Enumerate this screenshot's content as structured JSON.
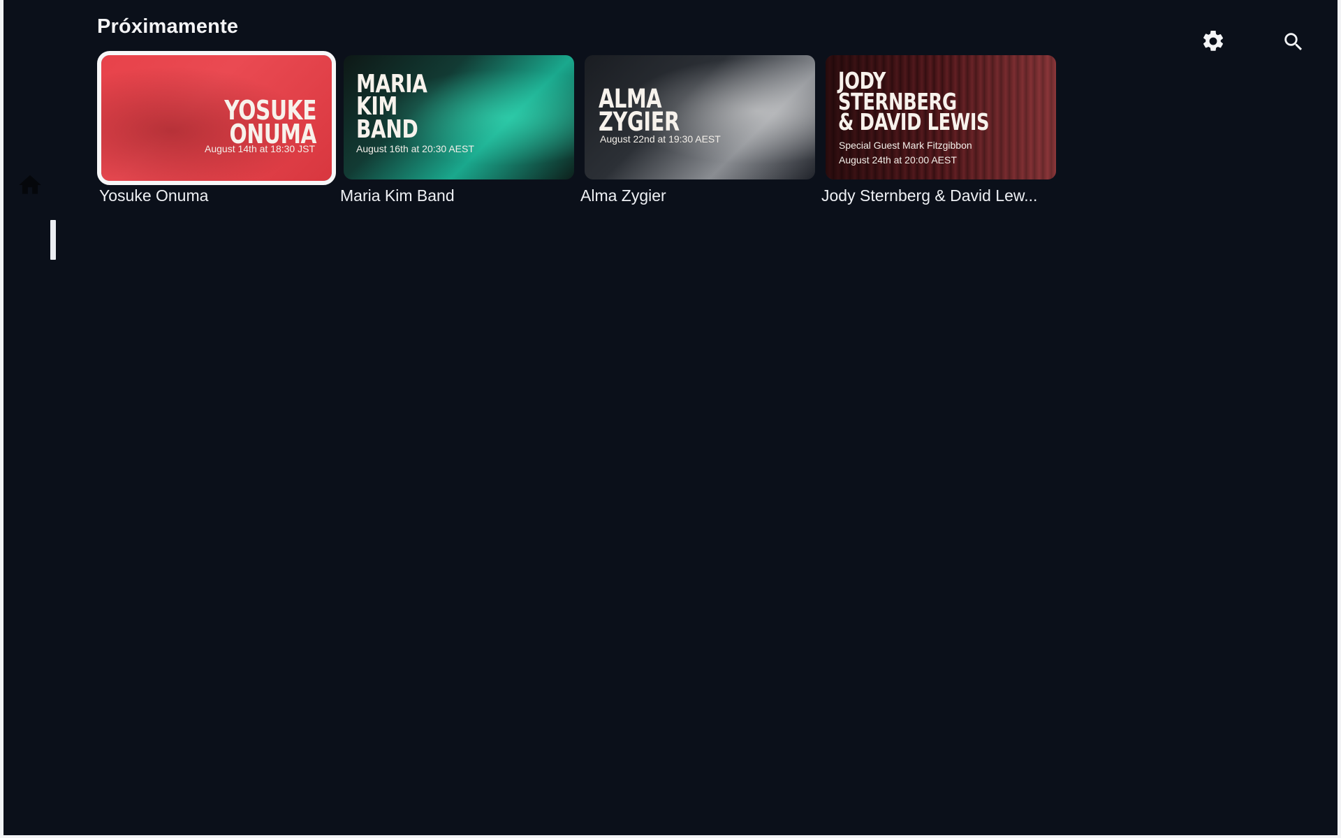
{
  "header": {
    "section_title": "Próximamente"
  },
  "icons": {
    "settings": "gear-icon",
    "search": "search-icon",
    "home": "home-icon"
  },
  "cards": [
    {
      "poster_title_line1": "YOSUKE",
      "poster_title_line2": "ONUMA",
      "poster_date": "August 14th at 18:30 JST",
      "label": "Yosuke Onuma",
      "focused": true
    },
    {
      "poster_title_line1": "MARIA",
      "poster_title_line2": "KIM",
      "poster_title_line3": "BAND",
      "poster_date": "August 16th at 20:30 AEST",
      "label": "Maria Kim Band"
    },
    {
      "poster_title_line1": "ALMA",
      "poster_title_line2": "ZYGIER",
      "poster_date": "August 22nd at 19:30 AEST",
      "label": "Alma Zygier"
    },
    {
      "poster_title_line1": "JODY",
      "poster_title_line2": "STERNBERG",
      "poster_title_line3": "& DAVID LEWIS",
      "poster_subtitle": "Special Guest Mark Fitzgibbon",
      "poster_date": "August 24th at 20:00 AEST",
      "label": "Jody Sternberg & David Lew..."
    }
  ],
  "colors": {
    "background": "#0b101a",
    "focus_outline": "#f7f7f8",
    "card1_accent": "#e7424a",
    "card2_accent": "#1aa88d",
    "card4_accent": "#6e2227"
  }
}
